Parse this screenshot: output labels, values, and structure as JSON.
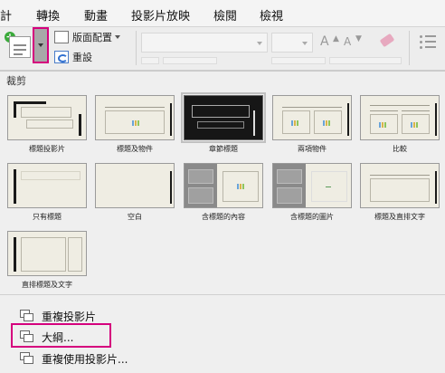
{
  "menubar": {
    "items": [
      "計",
      "轉換",
      "動畫",
      "投影片放映",
      "檢閱",
      "檢視"
    ]
  },
  "ribbon": {
    "new_slide_icon": "new-slide-icon",
    "layout_label": "版面配置",
    "reset_label": "重設"
  },
  "panel": {
    "section_label": "裁剪",
    "layouts": [
      {
        "label": "標題投影片"
      },
      {
        "label": "標題及物件"
      },
      {
        "label": "章節標題"
      },
      {
        "label": "兩項物件"
      },
      {
        "label": "比較"
      },
      {
        "label": "只有標題"
      },
      {
        "label": "空白"
      },
      {
        "label": "含標題的內容"
      },
      {
        "label": "含標題的圖片"
      },
      {
        "label": "標題及直排文字"
      },
      {
        "label": "直排標題及文字"
      }
    ],
    "commands": [
      {
        "label": "重複投影片",
        "icon": "duplicate-slide-icon"
      },
      {
        "label": "大綱...",
        "icon": "outline-icon"
      },
      {
        "label": "重複使用投影片...",
        "icon": "reuse-slides-icon"
      }
    ]
  },
  "colors": {
    "highlight": "#d5007d",
    "slide_bg": "#efede3",
    "dark_slide": "#161616"
  }
}
